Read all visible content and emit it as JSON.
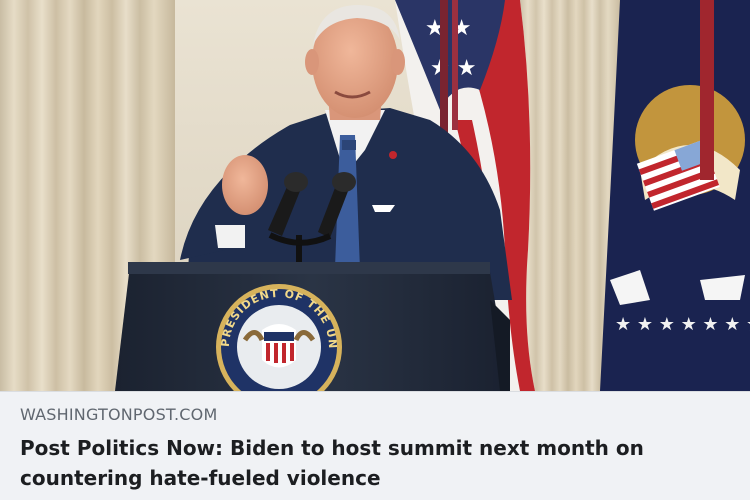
{
  "link_preview": {
    "domain": "WASHINGTONPOST.COM",
    "headline": "Post Politics Now: Biden to host summit next month on countering hate-fueled violence"
  },
  "photo": {
    "subject": "man-speaking-at-podium",
    "seal_text": "PRESIDENT OF THE UNITED"
  },
  "colors": {
    "caption_bg": "#f0f2f5",
    "domain_text": "#606770",
    "headline_text": "#1c1e21",
    "suit": "#1f2d4d",
    "podium": "#232c3c"
  }
}
